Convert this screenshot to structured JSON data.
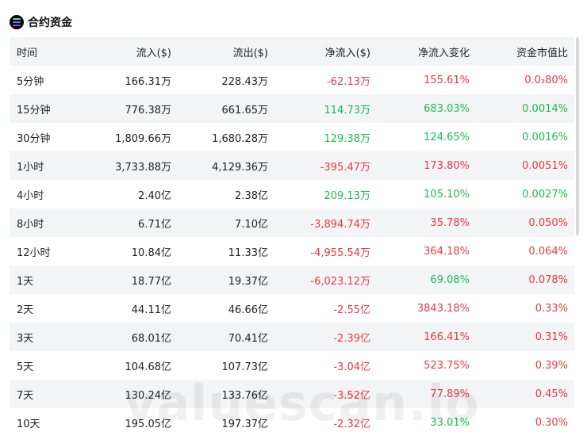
{
  "header": {
    "logo_icon": "solana-logo-icon",
    "title": "合约资金"
  },
  "table": {
    "columns": [
      "时间",
      "流入($)",
      "流出($)",
      "净流入($)",
      "净流入变化",
      "资金市值比"
    ],
    "rows": [
      {
        "period": "5分钟",
        "inflow": "166.31万",
        "outflow": "228.43万",
        "net": "-62.13万",
        "net_sign": "neg",
        "change": "155.61%",
        "change_sign": "neg",
        "ratio": "0.0₃80%",
        "ratio_sign": "neg"
      },
      {
        "period": "15分钟",
        "inflow": "776.38万",
        "outflow": "661.65万",
        "net": "114.73万",
        "net_sign": "pos",
        "change": "683.03%",
        "change_sign": "pos",
        "ratio": "0.0014%",
        "ratio_sign": "pos"
      },
      {
        "period": "30分钟",
        "inflow": "1,809.66万",
        "outflow": "1,680.28万",
        "net": "129.38万",
        "net_sign": "pos",
        "change": "124.65%",
        "change_sign": "pos",
        "ratio": "0.0016%",
        "ratio_sign": "pos"
      },
      {
        "period": "1小时",
        "inflow": "3,733.88万",
        "outflow": "4,129.36万",
        "net": "-395.47万",
        "net_sign": "neg",
        "change": "173.80%",
        "change_sign": "neg",
        "ratio": "0.0051%",
        "ratio_sign": "neg"
      },
      {
        "period": "4小时",
        "inflow": "2.40亿",
        "outflow": "2.38亿",
        "net": "209.13万",
        "net_sign": "pos",
        "change": "105.10%",
        "change_sign": "pos",
        "ratio": "0.0027%",
        "ratio_sign": "pos"
      },
      {
        "period": "8小时",
        "inflow": "6.71亿",
        "outflow": "7.10亿",
        "net": "-3,894.74万",
        "net_sign": "neg",
        "change": "35.78%",
        "change_sign": "neg",
        "ratio": "0.050%",
        "ratio_sign": "neg"
      },
      {
        "period": "12小时",
        "inflow": "10.84亿",
        "outflow": "11.33亿",
        "net": "-4,955.54万",
        "net_sign": "neg",
        "change": "364.18%",
        "change_sign": "neg",
        "ratio": "0.064%",
        "ratio_sign": "neg"
      },
      {
        "period": "1天",
        "inflow": "18.77亿",
        "outflow": "19.37亿",
        "net": "-6,023.12万",
        "net_sign": "neg",
        "change": "69.08%",
        "change_sign": "pos",
        "ratio": "0.078%",
        "ratio_sign": "neg"
      },
      {
        "period": "2天",
        "inflow": "44.11亿",
        "outflow": "46.66亿",
        "net": "-2.55亿",
        "net_sign": "neg",
        "change": "3843.18%",
        "change_sign": "neg",
        "ratio": "0.33%",
        "ratio_sign": "neg"
      },
      {
        "period": "3天",
        "inflow": "68.01亿",
        "outflow": "70.41亿",
        "net": "-2.39亿",
        "net_sign": "neg",
        "change": "166.41%",
        "change_sign": "neg",
        "ratio": "0.31%",
        "ratio_sign": "neg"
      },
      {
        "period": "5天",
        "inflow": "104.68亿",
        "outflow": "107.73亿",
        "net": "-3.04亿",
        "net_sign": "neg",
        "change": "523.75%",
        "change_sign": "neg",
        "ratio": "0.39%",
        "ratio_sign": "neg"
      },
      {
        "period": "7天",
        "inflow": "130.24亿",
        "outflow": "133.76亿",
        "net": "-3.52亿",
        "net_sign": "neg",
        "change": "77.89%",
        "change_sign": "neg",
        "ratio": "0.45%",
        "ratio_sign": "neg"
      },
      {
        "period": "10天",
        "inflow": "195.05亿",
        "outflow": "197.37亿",
        "net": "-2.32亿",
        "net_sign": "neg",
        "change": "33.01%",
        "change_sign": "pos",
        "ratio": "0.30%",
        "ratio_sign": "neg"
      }
    ]
  },
  "watermark": "valuescan.io",
  "colors": {
    "positive": "#1db954",
    "negative": "#ea3943",
    "stripe": "#f3f4f6"
  }
}
